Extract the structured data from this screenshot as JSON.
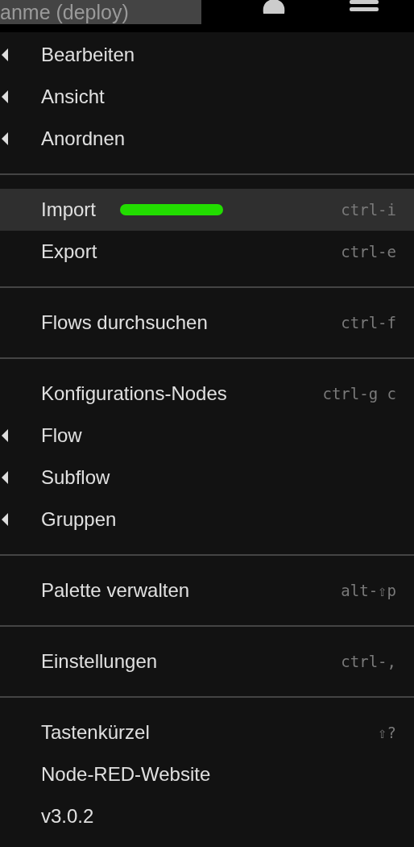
{
  "header": {
    "deploy_button": "anme (deploy)"
  },
  "menu": [
    {
      "kind": "submenu",
      "label": "Bearbeiten"
    },
    {
      "kind": "submenu",
      "label": "Ansicht"
    },
    {
      "kind": "submenu",
      "label": "Anordnen"
    },
    {
      "kind": "divider"
    },
    {
      "kind": "action",
      "label": "Import",
      "shortcut": "ctrl-i",
      "selected": true,
      "marker": true
    },
    {
      "kind": "action",
      "label": "Export",
      "shortcut": "ctrl-e",
      "selected": false
    },
    {
      "kind": "divider"
    },
    {
      "kind": "action",
      "label": "Flows durchsuchen",
      "shortcut": "ctrl-f",
      "selected": false
    },
    {
      "kind": "divider"
    },
    {
      "kind": "action",
      "label": "Konfigurations-Nodes",
      "shortcut": "ctrl-g c",
      "selected": false
    },
    {
      "kind": "submenu",
      "label": "Flow"
    },
    {
      "kind": "submenu",
      "label": "Subflow"
    },
    {
      "kind": "submenu",
      "label": "Gruppen"
    },
    {
      "kind": "divider"
    },
    {
      "kind": "action",
      "label": "Palette verwalten",
      "shortcut": "alt-⇧p",
      "selected": false
    },
    {
      "kind": "divider"
    },
    {
      "kind": "action",
      "label": "Einstellungen",
      "shortcut": "ctrl-,",
      "selected": false
    },
    {
      "kind": "divider"
    },
    {
      "kind": "action",
      "label": "Tastenkürzel",
      "shortcut": "⇧?",
      "selected": false
    },
    {
      "kind": "action",
      "label": "Node-RED-Website",
      "selected": false
    },
    {
      "kind": "action",
      "label": "v3.0.2",
      "selected": false
    }
  ]
}
